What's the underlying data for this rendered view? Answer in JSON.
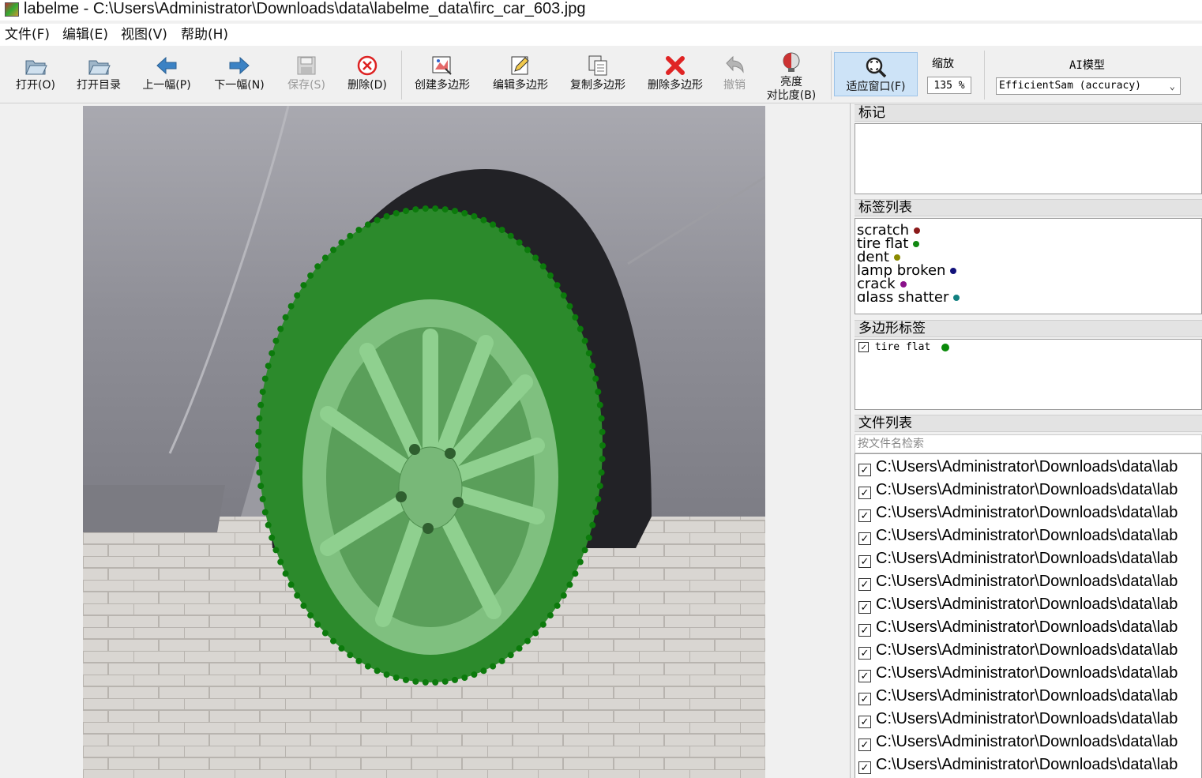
{
  "window": {
    "title": "labelme - C:\\Users\\Administrator\\Downloads\\data\\labelme_data\\firc_car_603.jpg"
  },
  "menu": [
    "文件(F)",
    "编辑(E)",
    "视图(V)",
    "帮助(H)"
  ],
  "toolbar": {
    "open": "打开(O)",
    "open_dir": "打开目录",
    "prev": "上一幅(P)",
    "next": "下一幅(N)",
    "save": "保存(S)",
    "delete": "删除(D)",
    "create_polygon": "创建多边形",
    "edit_polygon": "编辑多边形",
    "copy_polygon": "复制多边形",
    "delete_polygon": "删除多边形",
    "undo": "撤销",
    "brightness_line1": "亮度",
    "brightness_line2": "对比度(B)",
    "fit_window": "适应窗口(F)",
    "zoom_label": "缩放",
    "zoom_value": "135 %",
    "ai_label": "AI模型",
    "ai_model": "EfficientSam (accuracy)"
  },
  "panels": {
    "flags_title": "标记",
    "label_list_title": "标签列表",
    "polygon_labels_title": "多边形标签",
    "file_list_title": "文件列表",
    "file_search_placeholder": "按文件名检索"
  },
  "labels": [
    {
      "name": "scratch",
      "color": "#8b1a1a"
    },
    {
      "name": "tire flat",
      "color": "#118811"
    },
    {
      "name": "dent",
      "color": "#8a8a00"
    },
    {
      "name": "lamp broken",
      "color": "#11117a"
    },
    {
      "name": "crack",
      "color": "#8a118a"
    },
    {
      "name": "glass shatter",
      "color": "#118080"
    }
  ],
  "polygon_labels": [
    {
      "name": "tire flat",
      "checked": true,
      "color": "#0a8a0a"
    }
  ],
  "files": [
    "C:\\Users\\Administrator\\Downloads\\data\\lab",
    "C:\\Users\\Administrator\\Downloads\\data\\lab",
    "C:\\Users\\Administrator\\Downloads\\data\\lab",
    "C:\\Users\\Administrator\\Downloads\\data\\lab",
    "C:\\Users\\Administrator\\Downloads\\data\\lab",
    "C:\\Users\\Administrator\\Downloads\\data\\lab",
    "C:\\Users\\Administrator\\Downloads\\data\\lab",
    "C:\\Users\\Administrator\\Downloads\\data\\lab",
    "C:\\Users\\Administrator\\Downloads\\data\\lab",
    "C:\\Users\\Administrator\\Downloads\\data\\lab",
    "C:\\Users\\Administrator\\Downloads\\data\\lab",
    "C:\\Users\\Administrator\\Downloads\\data\\lab",
    "C:\\Users\\Administrator\\Downloads\\data\\lab",
    "C:\\Users\\Administrator\\Downloads\\data\\lab"
  ]
}
